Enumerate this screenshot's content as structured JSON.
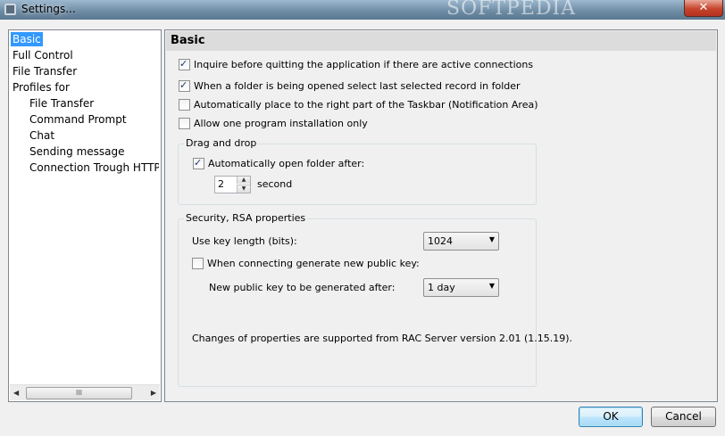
{
  "window": {
    "title": "Settings...",
    "watermark": "SOFTPEDIA",
    "close_label": "✕"
  },
  "tree": {
    "items": [
      {
        "label": "Basic",
        "selected": true
      },
      {
        "label": "Full Control"
      },
      {
        "label": "File Transfer"
      },
      {
        "label": "Profiles for"
      },
      {
        "label": "File Transfer"
      },
      {
        "label": "Command Prompt"
      },
      {
        "label": "Chat"
      },
      {
        "label": "Sending message"
      },
      {
        "label": "Connection Trough HTTP"
      }
    ],
    "scroll_thumb": "III"
  },
  "panel": {
    "title": "Basic",
    "options": [
      {
        "label": "Inquire before quitting the application if there are active connections",
        "checked": true
      },
      {
        "label": "When a folder is being opened select last selected record in folder",
        "checked": true
      },
      {
        "label": "Automatically place to the right part of the Taskbar (Notification Area)",
        "checked": false
      },
      {
        "label": "Allow one program installation only",
        "checked": false
      }
    ],
    "drag_drop": {
      "title": "Drag and drop",
      "auto_open_label": "Automatically open folder after:",
      "auto_open_checked": true,
      "delay_value": "2",
      "unit": "second"
    },
    "security": {
      "title": "Security, RSA properties",
      "key_length_label": "Use key length (bits):",
      "key_length_value": "1024",
      "gen_key_label": "When connecting generate new public key:",
      "gen_key_checked": false,
      "after_label": "New public key to be generated after:",
      "after_value": "1 day",
      "note": "Changes of properties are supported from RAC Server version 2.01 (1.15.19)."
    }
  },
  "buttons": {
    "ok": "OK",
    "cancel": "Cancel"
  }
}
